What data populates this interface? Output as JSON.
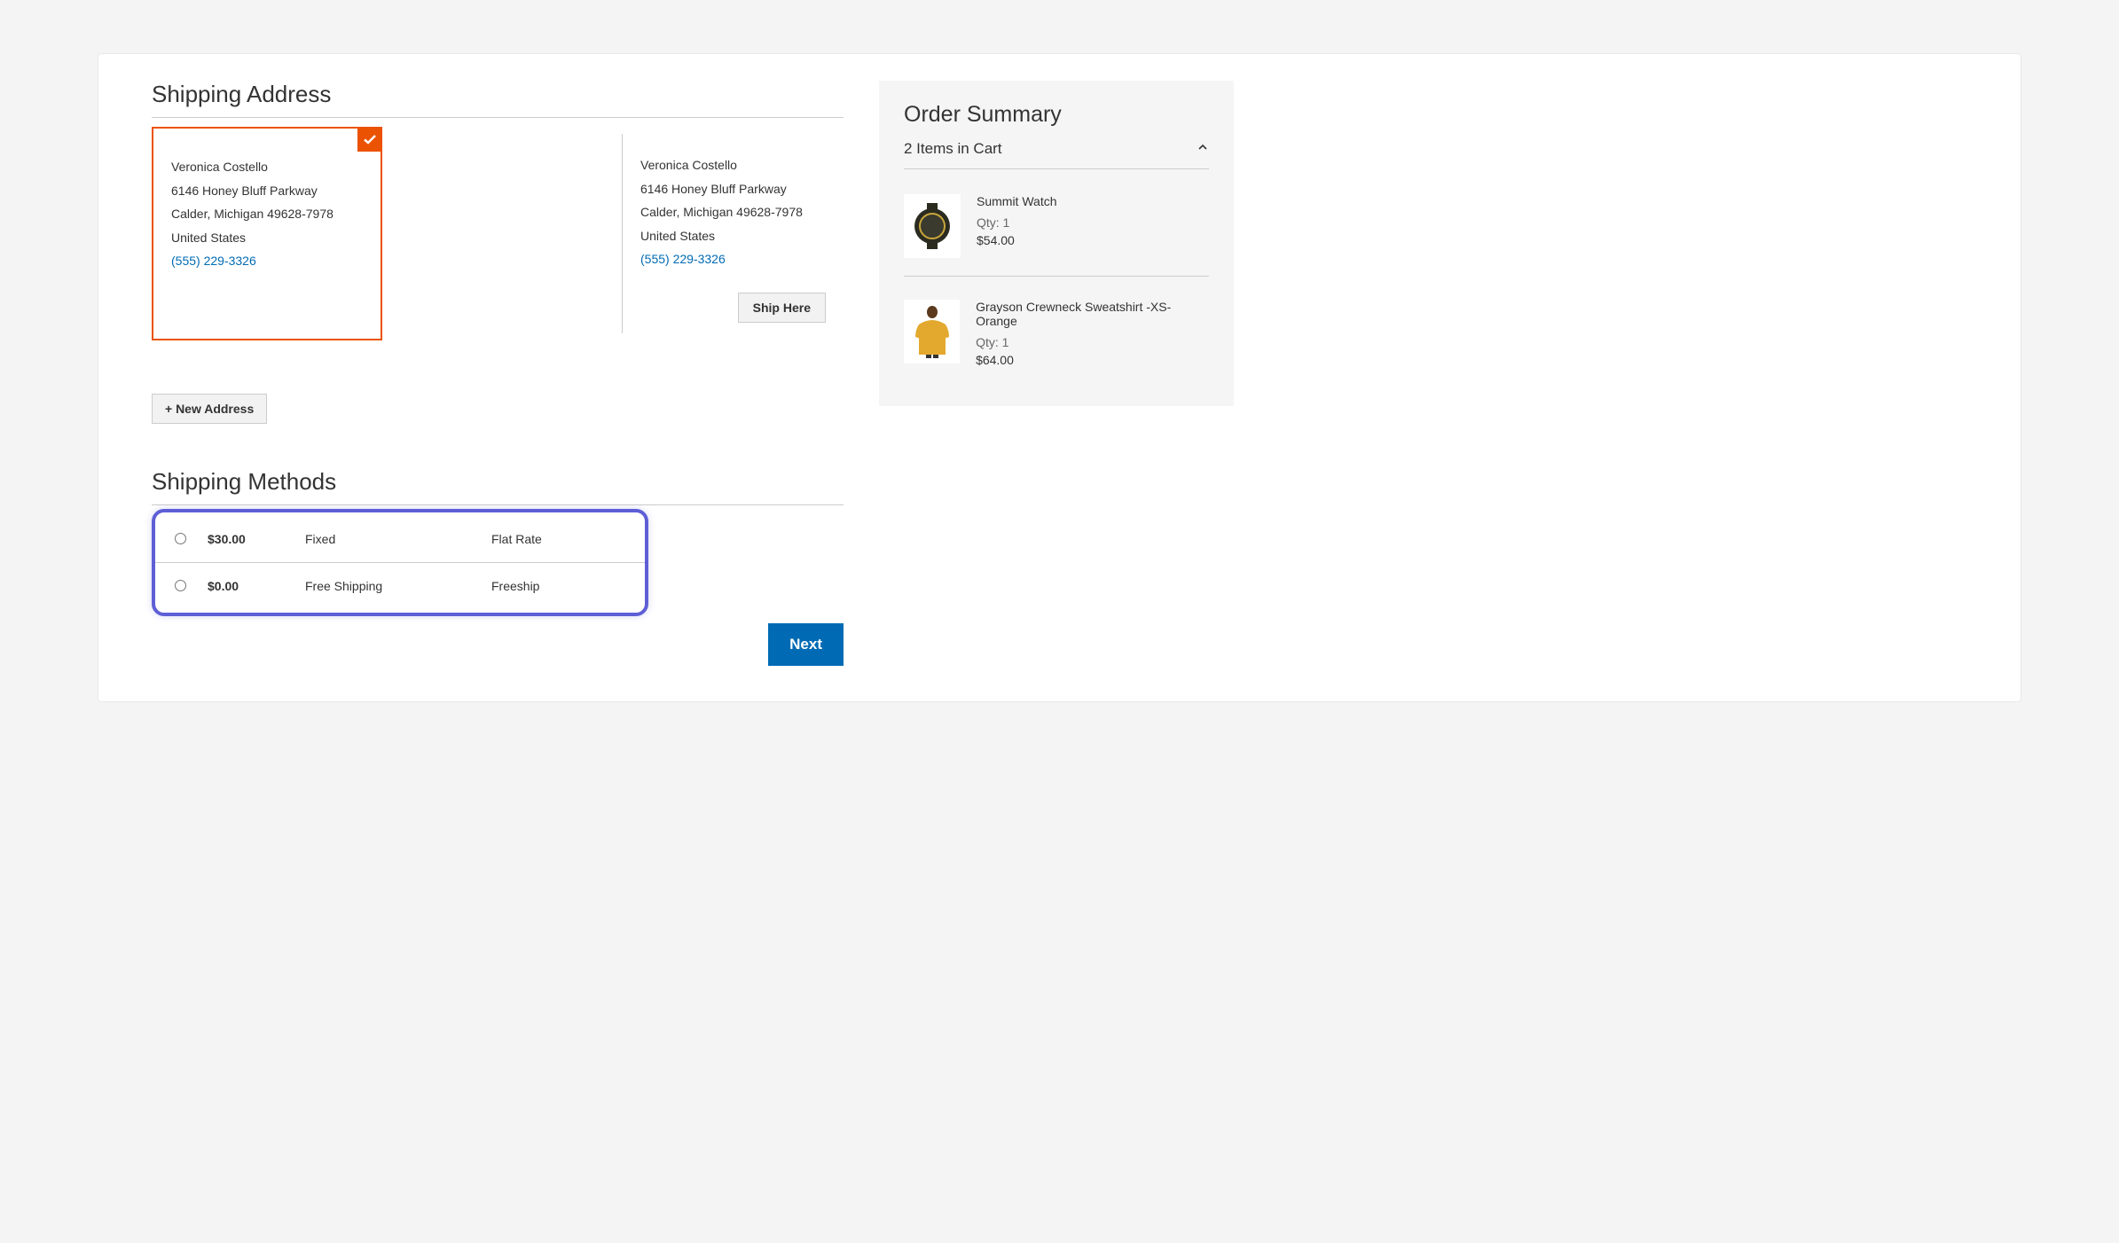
{
  "shipping": {
    "title": "Shipping Address",
    "addresses": [
      {
        "name": "Veronica Costello",
        "street": "6146 Honey Bluff Parkway",
        "city_state_zip": "Calder, Michigan 49628-7978",
        "country": "United States",
        "phone": "(555) 229-3326",
        "selected": true
      },
      {
        "name": "Veronica Costello",
        "street": "6146 Honey Bluff Parkway",
        "city_state_zip": "Calder, Michigan 49628-7978",
        "country": "United States",
        "phone": "(555) 229-3326",
        "selected": false
      }
    ],
    "ship_here_label": "Ship Here",
    "new_address_label": "+ New Address"
  },
  "methods": {
    "title": "Shipping Methods",
    "options": [
      {
        "price": "$30.00",
        "label": "Fixed",
        "carrier": "Flat Rate"
      },
      {
        "price": "$0.00",
        "label": "Free Shipping",
        "carrier": "Freeship"
      }
    ]
  },
  "buttons": {
    "next": "Next"
  },
  "summary": {
    "title": "Order Summary",
    "cart_count_label": "2 Items in Cart",
    "items": [
      {
        "name": "Summit Watch",
        "qty": "Qty: 1",
        "price": "$54.00"
      },
      {
        "name": "Grayson Crewneck Sweatshirt -XS-Orange",
        "qty": "Qty: 1",
        "price": "$64.00"
      }
    ]
  }
}
